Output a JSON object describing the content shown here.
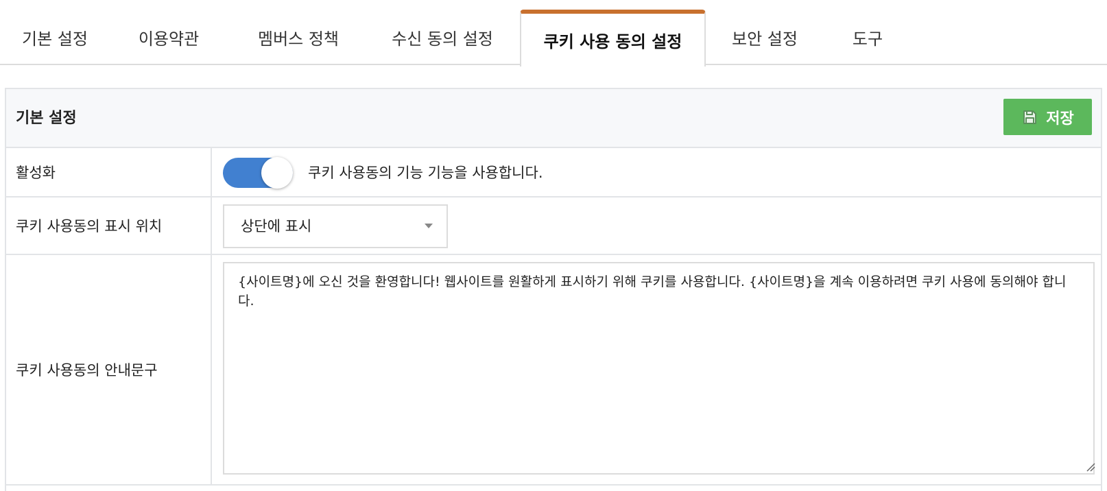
{
  "tabs": [
    {
      "label": "기본 설정",
      "active": false
    },
    {
      "label": "이용약관",
      "active": false
    },
    {
      "label": "멤버스 정책",
      "active": false
    },
    {
      "label": "수신 동의 설정",
      "active": false
    },
    {
      "label": "쿠키 사용 동의 설정",
      "active": true
    },
    {
      "label": "보안 설정",
      "active": false
    },
    {
      "label": "도구",
      "active": false
    }
  ],
  "colors": {
    "active_tab_accent": "#c8702e",
    "save_button": "#5cb85c",
    "toggle_on": "#4180d0"
  },
  "panel": {
    "title": "기본 설정",
    "save_label": "저장",
    "save_icon": "floppy-disk-icon"
  },
  "settings": {
    "activation": {
      "label": "활성화",
      "enabled": true,
      "description": "쿠키 사용동의 기능 기능을 사용합니다."
    },
    "position": {
      "label": "쿠키 사용동의 표시 위치",
      "selected": "상단에 표시"
    },
    "message": {
      "label": "쿠키 사용동의 안내문구",
      "value": "{사이트명}에 오신 것을 환영합니다! 웹사이트를 원활하게 표시하기 위해 쿠키를 사용합니다. {사이트명}을 계속 이용하려면 쿠키 사용에 동의해야 합니다."
    }
  }
}
